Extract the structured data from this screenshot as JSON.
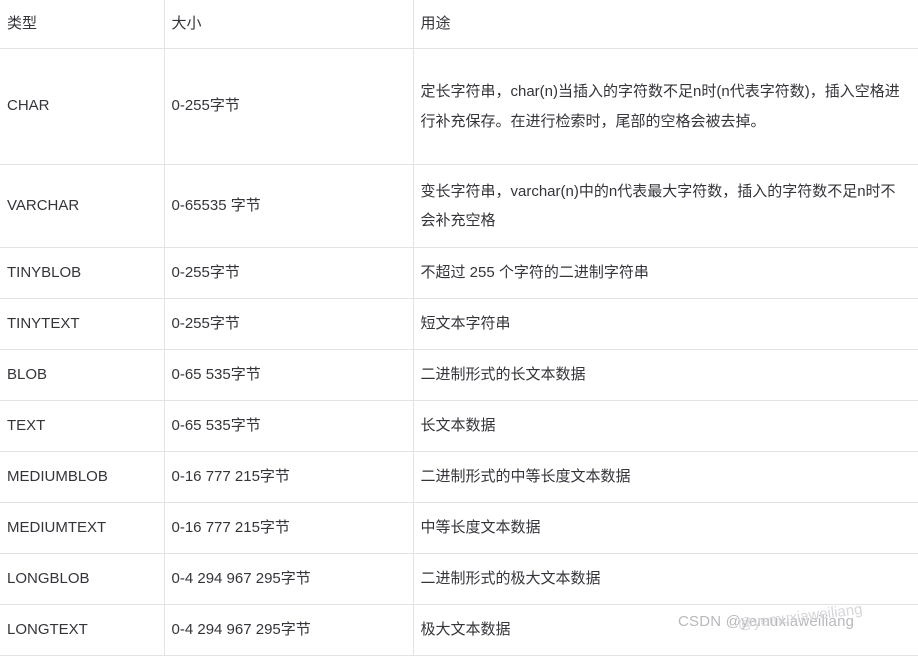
{
  "table": {
    "columns": [
      "类型",
      "大小",
      "用途"
    ],
    "rows": [
      {
        "type": "CHAR",
        "size": "0-255字节",
        "usage": "定长字符串，char(n)当插入的字符数不足n时(n代表字符数)，插入空格进行补充保存。在进行检索时，尾部的空格会被去掉。",
        "height": "tall"
      },
      {
        "type": "VARCHAR",
        "size": "0-65535 字节",
        "usage": "变长字符串，varchar(n)中的n代表最大字符数，插入的字符数不足n时不会补充空格",
        "height": "mid"
      },
      {
        "type": "TINYBLOB",
        "size": "0-255字节",
        "usage": "不超过 255 个字符的二进制字符串",
        "height": "std"
      },
      {
        "type": "TINYTEXT",
        "size": "0-255字节",
        "usage": "短文本字符串",
        "height": "std"
      },
      {
        "type": "BLOB",
        "size": "0-65 535字节",
        "usage": "二进制形式的长文本数据",
        "height": "std"
      },
      {
        "type": "TEXT",
        "size": "0-65 535字节",
        "usage": "长文本数据",
        "height": "std"
      },
      {
        "type": "MEDIUMBLOB",
        "size": "0-16 777 215字节",
        "usage": "二进制形式的中等长度文本数据",
        "height": "std"
      },
      {
        "type": "MEDIUMTEXT",
        "size": "0-16 777 215字节",
        "usage": "中等长度文本数据",
        "height": "std"
      },
      {
        "type": "LONGBLOB",
        "size": "0-4 294 967 295字节",
        "usage": "二进制形式的极大文本数据",
        "height": "std"
      },
      {
        "type": "LONGTEXT",
        "size": "0-4 294 967 295字节",
        "usage": "极大文本数据",
        "height": "std"
      }
    ]
  },
  "watermark": {
    "text": "CSDN @yemuxiaweiliang",
    "overlay_text": "@yemuxiaweiliang",
    "color": "#b9b9bd"
  },
  "style": {
    "border_color": "#e3e3e6",
    "text_color": "#34343b",
    "background": "#ffffff"
  }
}
